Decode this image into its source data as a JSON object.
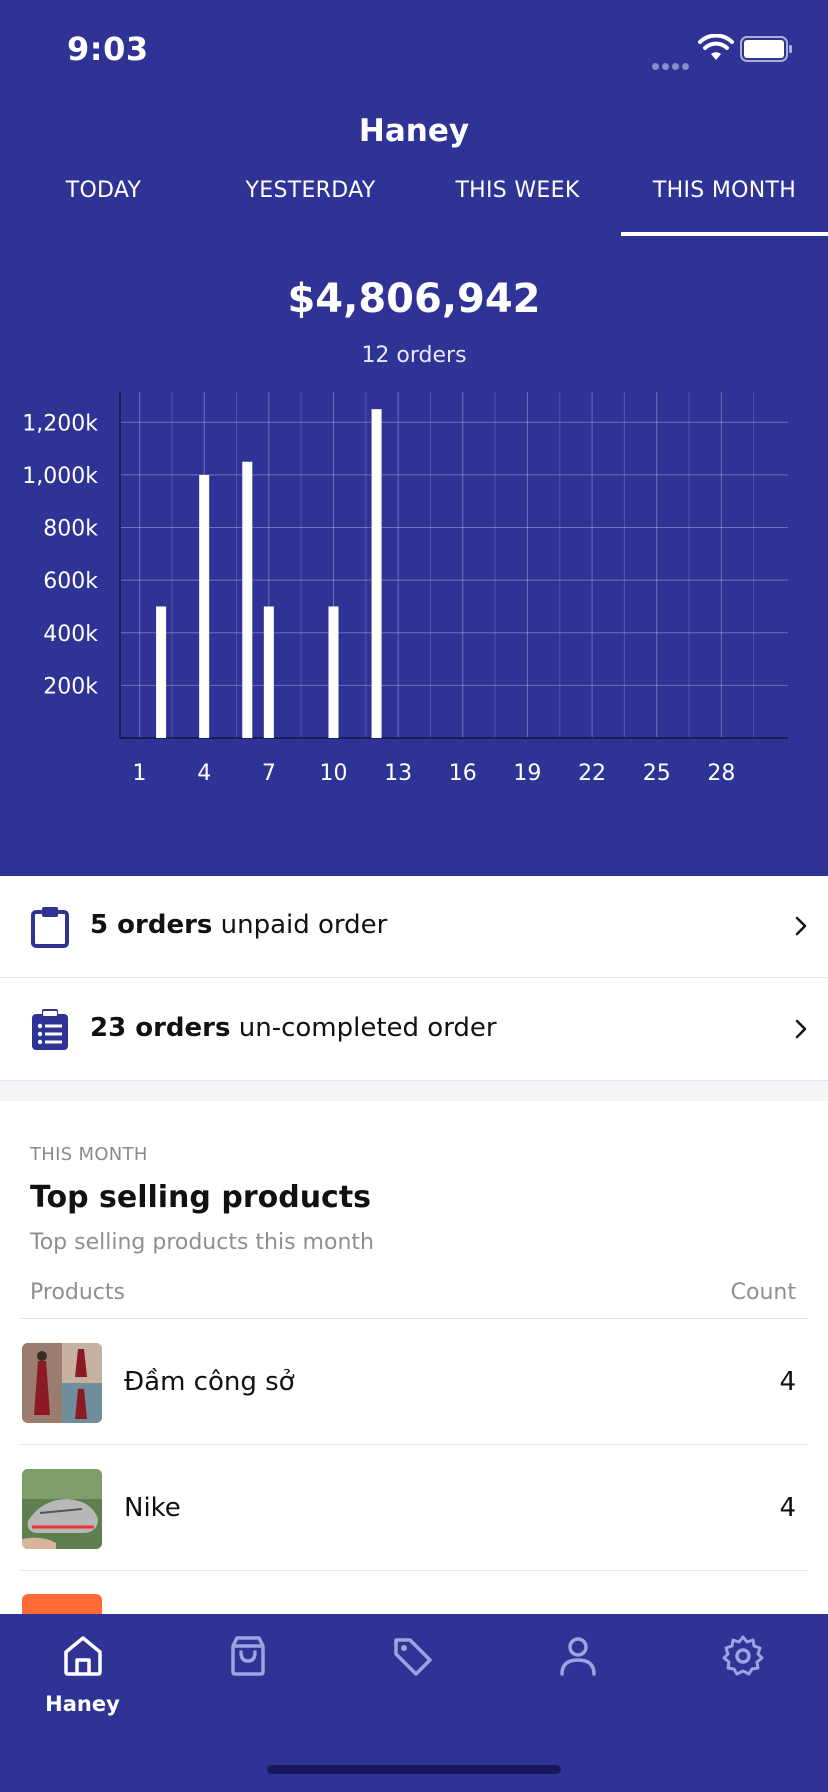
{
  "status_bar": {
    "time": "9:03"
  },
  "header": {
    "title": "Haney"
  },
  "tabs": [
    {
      "label": "TODAY",
      "active": false
    },
    {
      "label": "YESTERDAY",
      "active": false
    },
    {
      "label": "THIS WEEK",
      "active": false
    },
    {
      "label": "THIS MONTH",
      "active": true
    }
  ],
  "summary": {
    "revenue": "$4,806,942",
    "orders": "12 orders"
  },
  "chart_data": {
    "type": "bar",
    "x": [
      2,
      4,
      6,
      7,
      10,
      12
    ],
    "values": [
      500,
      1000,
      1050,
      500,
      500,
      1250
    ],
    "xticks": [
      "1",
      "4",
      "7",
      "10",
      "13",
      "16",
      "19",
      "22",
      "25",
      "28"
    ],
    "yticks": [
      "200k",
      "400k",
      "600k",
      "800k",
      "1,000k",
      "1,200k"
    ],
    "xlim": [
      0,
      31
    ],
    "ylim": [
      0,
      1300
    ],
    "grid": true,
    "bar_color": "#ffffff"
  },
  "order_rows": [
    {
      "count": "5 orders",
      "text": "unpaid order",
      "icon": "clipboard-icon"
    },
    {
      "count": "23 orders",
      "text": "un-completed order",
      "icon": "clipboard-list-icon"
    }
  ],
  "top_selling": {
    "kicker": "THIS MONTH",
    "title": "Top selling products",
    "subtitle": "Top selling products this month",
    "col_products": "Products",
    "col_count": "Count",
    "items": [
      {
        "name": "Đầm công sở",
        "count": "4",
        "thumb": "dress-photo"
      },
      {
        "name": "Nike",
        "count": "4",
        "thumb": "sneaker-photo"
      }
    ]
  },
  "tabbar": {
    "items": [
      {
        "label": "Haney",
        "icon": "home-icon",
        "active": true
      },
      {
        "label": "",
        "icon": "shopping-bag-icon",
        "active": false
      },
      {
        "label": "",
        "icon": "tag-icon",
        "active": false
      },
      {
        "label": "",
        "icon": "user-icon",
        "active": false
      },
      {
        "label": "",
        "icon": "gear-icon",
        "active": false
      }
    ]
  },
  "colors": {
    "primary": "#2f3396",
    "surface": "#ffffff",
    "muted_text": "#8f8f8f",
    "icon": "#2f3396"
  }
}
